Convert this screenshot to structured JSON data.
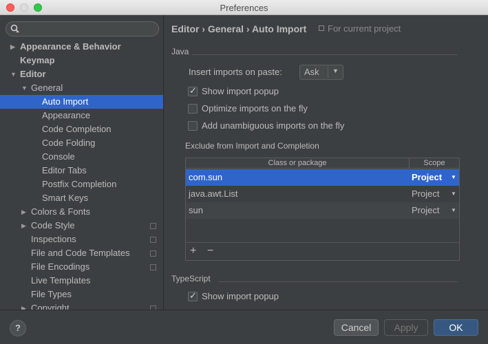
{
  "window": {
    "title": "Preferences"
  },
  "search": {
    "placeholder": ""
  },
  "sidebar": {
    "items": [
      {
        "label": "Appearance & Behavior",
        "arrow": "▶",
        "bold": true,
        "level": 0
      },
      {
        "label": "Keymap",
        "arrow": "",
        "bold": true,
        "level": 0
      },
      {
        "label": "Editor",
        "arrow": "▼",
        "bold": true,
        "level": 0
      },
      {
        "label": "General",
        "arrow": "▼",
        "bold": false,
        "level": 1
      },
      {
        "label": "Auto Import",
        "arrow": "",
        "bold": false,
        "level": 2,
        "selected": true
      },
      {
        "label": "Appearance",
        "arrow": "",
        "bold": false,
        "level": 2
      },
      {
        "label": "Code Completion",
        "arrow": "",
        "bold": false,
        "level": 2
      },
      {
        "label": "Code Folding",
        "arrow": "",
        "bold": false,
        "level": 2
      },
      {
        "label": "Console",
        "arrow": "",
        "bold": false,
        "level": 2
      },
      {
        "label": "Editor Tabs",
        "arrow": "",
        "bold": false,
        "level": 2
      },
      {
        "label": "Postfix Completion",
        "arrow": "",
        "bold": false,
        "level": 2
      },
      {
        "label": "Smart Keys",
        "arrow": "",
        "bold": false,
        "level": 2
      },
      {
        "label": "Colors & Fonts",
        "arrow": "▶",
        "bold": false,
        "level": 1
      },
      {
        "label": "Code Style",
        "arrow": "▶",
        "bold": false,
        "level": 1,
        "project": true
      },
      {
        "label": "Inspections",
        "arrow": "",
        "bold": false,
        "level": 1,
        "project": true
      },
      {
        "label": "File and Code Templates",
        "arrow": "",
        "bold": false,
        "level": 1,
        "project": true
      },
      {
        "label": "File Encodings",
        "arrow": "",
        "bold": false,
        "level": 1,
        "project": true
      },
      {
        "label": "Live Templates",
        "arrow": "",
        "bold": false,
        "level": 1
      },
      {
        "label": "File Types",
        "arrow": "",
        "bold": false,
        "level": 1
      },
      {
        "label": "Copyright",
        "arrow": "▶",
        "bold": false,
        "level": 1,
        "project": true
      }
    ]
  },
  "header": {
    "breadcrumb": "Editor › General › Auto Import",
    "scope_note": "For current project"
  },
  "java": {
    "section_title": "Java",
    "insert_label": "Insert imports on paste:",
    "insert_value": "Ask",
    "options": [
      {
        "label": "Show import popup",
        "checked": true
      },
      {
        "label": "Optimize imports on the fly",
        "checked": false
      },
      {
        "label": "Add unambiguous imports on the fly",
        "checked": false
      }
    ],
    "exclude_title": "Exclude from Import and Completion",
    "table": {
      "col_class": "Class or package",
      "col_scope": "Scope",
      "rows": [
        {
          "class": "com.sun",
          "scope": "Project",
          "selected": true
        },
        {
          "class": "java.awt.List",
          "scope": "Project",
          "selected": false
        },
        {
          "class": "sun",
          "scope": "Project",
          "selected": false
        }
      ],
      "add_label": "+",
      "remove_label": "−"
    }
  },
  "typescript": {
    "section_title": "TypeScript",
    "options": [
      {
        "label": "Show import popup",
        "checked": true
      }
    ]
  },
  "buttons": {
    "help": "?",
    "cancel": "Cancel",
    "apply": "Apply",
    "ok": "OK"
  }
}
